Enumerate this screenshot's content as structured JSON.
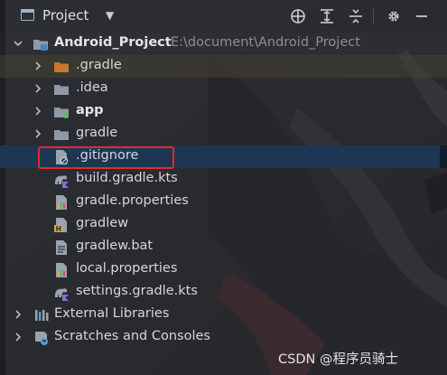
{
  "header": {
    "title": "Project",
    "icons": [
      "project-view-icon",
      "chevron-down-icon",
      "crosshair-icon",
      "expand-all-icon",
      "collapse-all-icon",
      "gear-icon",
      "minimize-icon"
    ]
  },
  "tree": {
    "root": {
      "label": "Android_Project",
      "path": "E:\\document\\Android_Project"
    },
    "items": [
      {
        "label": ".gradle",
        "icon": "folder-orange-icon"
      },
      {
        "label": ".idea",
        "icon": "folder-icon"
      },
      {
        "label": "app",
        "icon": "module-folder-icon"
      },
      {
        "label": "gradle",
        "icon": "folder-icon"
      },
      {
        "label": ".gitignore",
        "icon": "gitignore-file-icon"
      },
      {
        "label": "build.gradle.kts",
        "icon": "gradle-kts-icon"
      },
      {
        "label": "gradle.properties",
        "icon": "properties-file-icon"
      },
      {
        "label": "gradlew",
        "icon": "shell-script-icon"
      },
      {
        "label": "gradlew.bat",
        "icon": "batch-file-icon"
      },
      {
        "label": "local.properties",
        "icon": "properties-file-icon"
      },
      {
        "label": "settings.gradle.kts",
        "icon": "gradle-kts-icon"
      }
    ],
    "external_libraries": "External Libraries",
    "scratches": "Scratches and Consoles"
  },
  "watermark": "CSDN @程序员骑士",
  "colors": {
    "selection": "#1c3654",
    "highlight_box": "#e52828",
    "background": "#2b2d31"
  }
}
